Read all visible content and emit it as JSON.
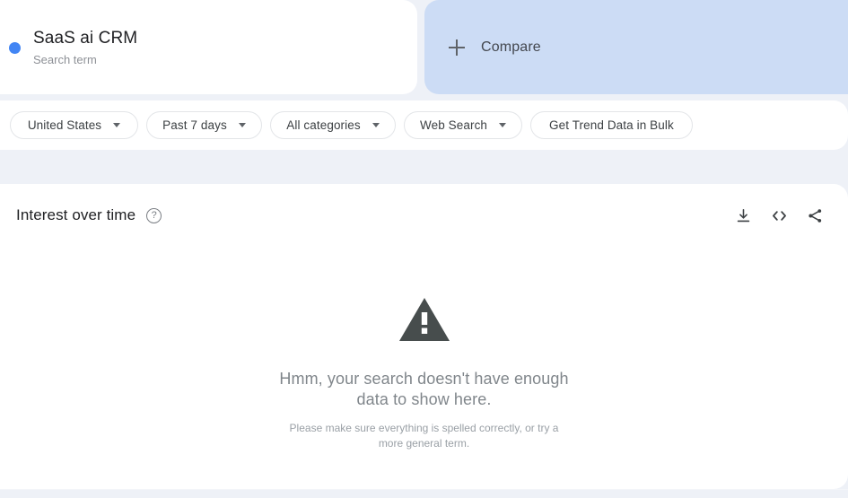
{
  "search_term": {
    "label": "SaaS ai CRM",
    "type_label": "Search term",
    "dot_color": "#4285f4"
  },
  "compare": {
    "label": "Compare",
    "icon": "plus-icon",
    "panel_color": "#ccdcf5"
  },
  "filters": {
    "region": "United States",
    "time_range": "Past 7 days",
    "category": "All categories",
    "search_type": "Web Search",
    "bulk_button": "Get Trend Data in Bulk"
  },
  "interest_over_time": {
    "title": "Interest over time",
    "help_icon_glyph": "?",
    "actions": [
      {
        "name": "download-icon",
        "tooltip": "Download"
      },
      {
        "name": "embed-code-icon",
        "tooltip": "Embed"
      },
      {
        "name": "share-icon",
        "tooltip": "Share"
      }
    ],
    "empty_state": {
      "icon": "warning-triangle-icon",
      "icon_color": "#474d4d",
      "message": "Hmm, your search doesn't have enough data to show here.",
      "hint": "Please make sure everything is spelled correctly, or try a more general term."
    }
  }
}
